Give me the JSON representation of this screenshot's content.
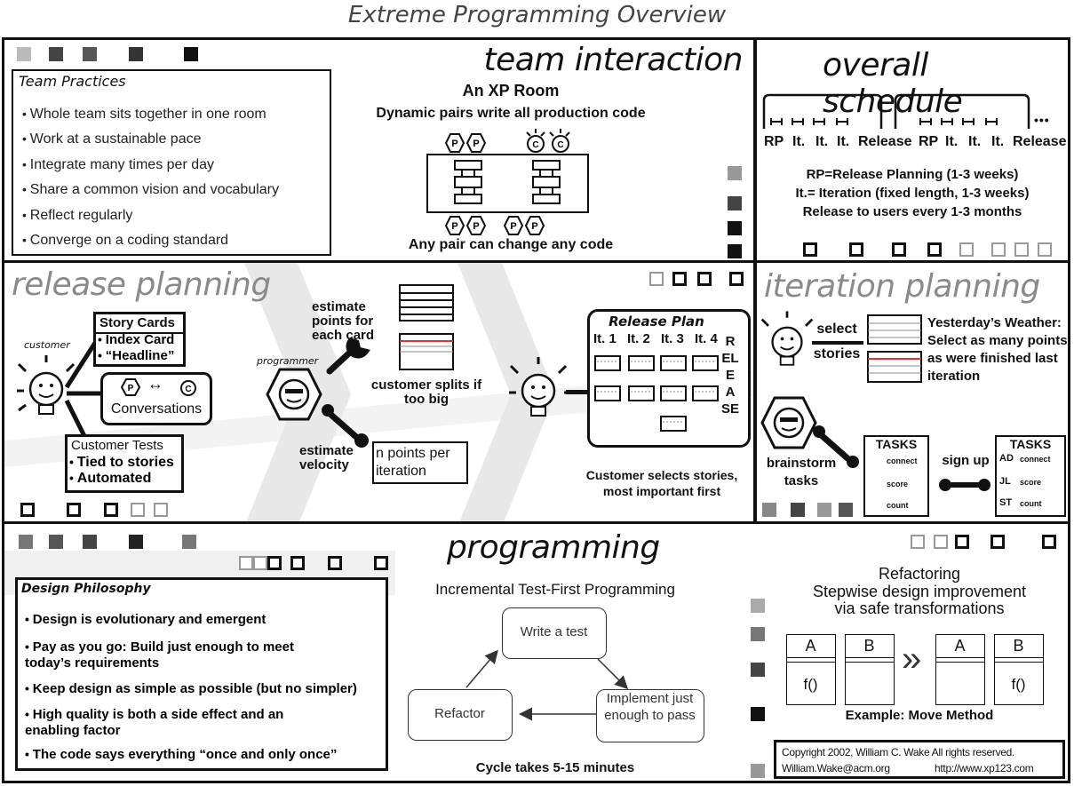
{
  "title": "Extreme Programming Overview",
  "team_interaction": {
    "heading": "team interaction",
    "practices_title": "Team Practices",
    "practices": [
      "Whole team sits together in one room",
      "Work at a sustainable pace",
      "Integrate many times per day",
      "Share a common vision and vocabulary",
      "Reflect regularly",
      "Converge on a coding standard"
    ],
    "room_title": "An XP Room",
    "room_subtitle": "Dynamic pairs write all production code",
    "room_caption": "Any pair can change any code",
    "p_glyph": "P",
    "c_glyph": "C"
  },
  "overall_schedule": {
    "heading": "overall schedule",
    "timeline_labels": [
      "RP",
      "It.",
      "It.",
      "It.",
      "Release",
      "RP",
      "It.",
      "It.",
      "It.",
      "Release"
    ],
    "ellipsis": "•••",
    "notes": [
      "RP=Release Planning (1-3 weeks)",
      "It.= Iteration (fixed length, 1-3 weeks)",
      "Release to users every 1-3 months"
    ]
  },
  "release_planning": {
    "heading": "release planning",
    "customer_label": "customer",
    "story_cards_title": "Story Cards",
    "story_cards_items": [
      "Index Card",
      "“Headline”"
    ],
    "conversations_label": "Conversations",
    "conversations_arrow": "↔",
    "customer_tests_title": "Customer Tests",
    "customer_tests_items": [
      "Tied to stories",
      "Automated"
    ],
    "programmer_label": "programmer",
    "estimate_points": "estimate points for each card",
    "customer_splits": "customer splits if too big",
    "estimate_velocity": "estimate velocity",
    "velocity_box": "n points per iteration",
    "release_plan_title": "Release Plan",
    "release_plan_iterations": [
      "It. 1",
      "It. 2",
      "It. 3",
      "It. 4"
    ],
    "release_vertical": "RELEASE",
    "selects_caption": "Customer selects stories, most important first"
  },
  "iteration_planning": {
    "heading": "iteration planning",
    "select_label": "select",
    "stories_label": "stories",
    "weather_text": "Yesterday’s Weather: Select as many points as were finished last iteration",
    "brainstorm_label": "brainstorm tasks",
    "signup_label": "sign up",
    "tasks_title": "TASKS",
    "tasks": [
      "connect",
      "score",
      "count"
    ],
    "assignees": [
      "AD",
      "JL",
      "ST"
    ]
  },
  "programming": {
    "heading": "programming",
    "design_title": "Design Philosophy",
    "design_items": [
      "Design is evolutionary and emergent",
      "Pay as you go: Build just enough to meet today’s requirements",
      "Keep design as simple as possible (but no simpler)",
      "High quality is both a side effect and an enabling factor",
      "The code says everything “once and only once”"
    ],
    "tfp_title": "Incremental Test-First Programming",
    "cycle_nodes": [
      "Write a test",
      "Implement just enough to pass",
      "Refactor"
    ],
    "cycle_caption": "Cycle takes 5-15 minutes",
    "refactoring_title": "Refactoring",
    "refactoring_sub1": "Stepwise design improvement",
    "refactoring_sub2": "via safe transformations",
    "class_a": "A",
    "class_b": "B",
    "method": "f()",
    "move_arrow": "»",
    "example_caption": "Example: Move Method",
    "copyright": "Copyright 2002, William C. Wake All rights reserved.",
    "email": "William.Wake@acm.org",
    "url": "http://www.xp123.com"
  }
}
